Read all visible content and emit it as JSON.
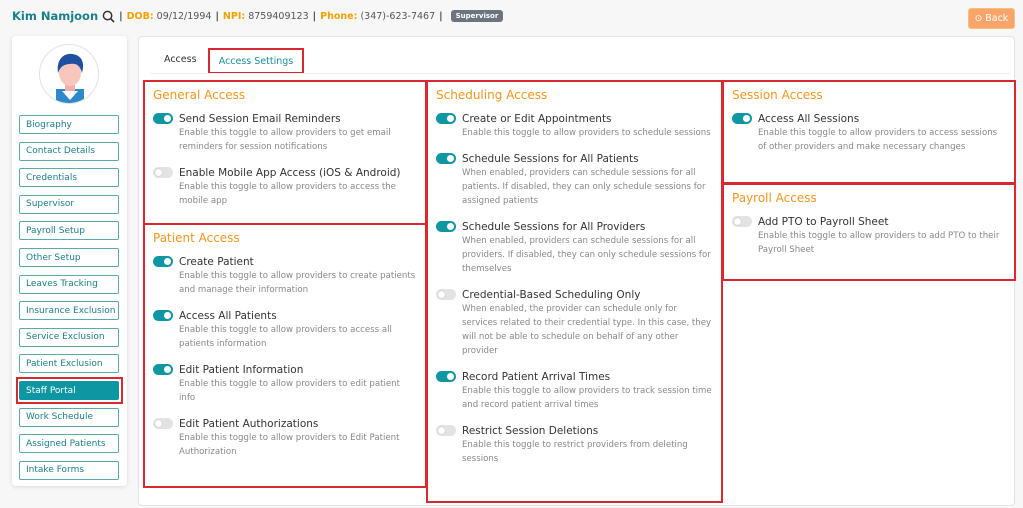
{
  "header": {
    "name": "Kim Namjoon",
    "dob_label": "DOB:",
    "dob": "09/12/1994",
    "npi_label": "NPI:",
    "npi": "8759409123",
    "phone_label": "Phone:",
    "phone": "(347)-623-7467",
    "badge": "Supervisor",
    "back": "Back"
  },
  "sidebar": {
    "items": [
      "Biography",
      "Contact Details",
      "Credentials",
      "Supervisor",
      "Payroll Setup",
      "Other Setup",
      "Leaves Tracking",
      "Insurance Exclusion",
      "Service Exclusion",
      "Patient Exclusion",
      "Staff Portal",
      "Work Schedule",
      "Assigned Patients",
      "Intake Forms"
    ],
    "active": "Staff Portal"
  },
  "tabs": [
    "Access",
    "Access Settings"
  ],
  "active_tab": "Access Settings",
  "colors": {
    "accent": "#0e96a3",
    "heading": "#f0961e",
    "highlight": "#d9282f"
  },
  "sections": [
    {
      "title": "General Access",
      "items": [
        {
          "label": "Send Session Email Reminders",
          "desc": "Enable this toggle to allow providers to get email reminders for session notifications",
          "on": true
        },
        {
          "label": "Enable Mobile App Access (iOS & Android)",
          "desc": "Enable this toggle to allow providers to access the mobile app",
          "on": false
        }
      ]
    },
    {
      "title": "Patient Access",
      "items": [
        {
          "label": "Create Patient",
          "desc": "Enable this toggle to allow providers to create patients and manage their information",
          "on": true
        },
        {
          "label": "Access All Patients",
          "desc": "Enable this toggle to allow providers to access all patients information",
          "on": true
        },
        {
          "label": "Edit Patient Information",
          "desc": "Enable this toggle to allow providers to edit patient info",
          "on": true
        },
        {
          "label": "Edit Patient Authorizations",
          "desc": "Enable this toggle to allow providers to Edit Patient Authorization",
          "on": false
        }
      ]
    },
    {
      "title": "Scheduling Access",
      "items": [
        {
          "label": "Create or Edit Appointments",
          "desc": "Enable this toggle to allow providers to schedule sessions",
          "on": true
        },
        {
          "label": "Schedule Sessions for All Patients",
          "desc": "When enabled, providers can schedule sessions for all patients. If disabled, they can only schedule sessions for assigned patients",
          "on": true
        },
        {
          "label": "Schedule Sessions for All Providers",
          "desc": "When enabled, providers can schedule sessions for all providers. If disabled, they can only schedule sessions for themselves",
          "on": true
        },
        {
          "label": "Credential-Based Scheduling Only",
          "desc": "When enabled, the provider can schedule only for services related to their credential type. In this case, they will not be able to schedule on behalf of any other provider",
          "on": false
        },
        {
          "label": "Record Patient Arrival Times",
          "desc": "Enable this toggle to allow providers to track session time and record patient arrival times",
          "on": true
        },
        {
          "label": "Restrict Session Deletions",
          "desc": "Enable this toggle to restrict providers from deleting sessions",
          "on": false
        }
      ]
    },
    {
      "title": "Session Access",
      "items": [
        {
          "label": "Access All Sessions",
          "desc": "Enable this toggle to allow providers to access sessions of other providers and make necessary changes",
          "on": true
        }
      ]
    },
    {
      "title": "Payroll Access",
      "items": [
        {
          "label": "Add PTO to Payroll Sheet",
          "desc": "Enable this toggle to allow providers to add PTO to their Payroll Sheet",
          "on": false
        }
      ]
    }
  ]
}
